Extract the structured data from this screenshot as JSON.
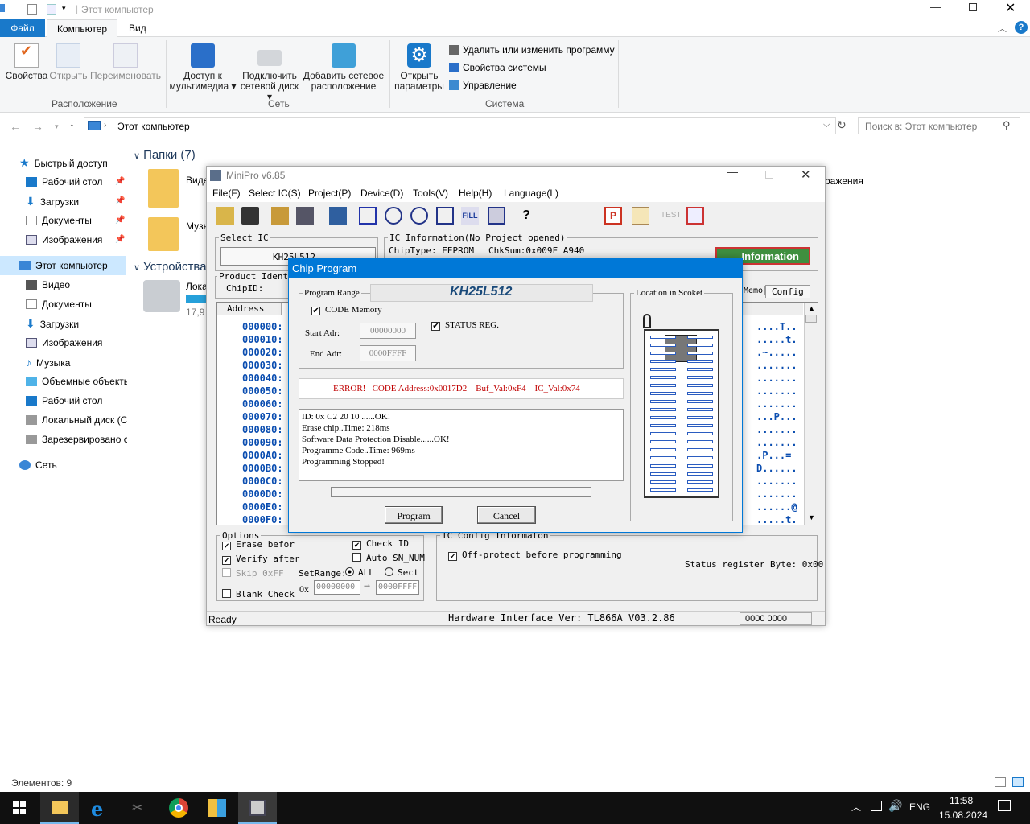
{
  "explorer": {
    "title": "Этот компьютер",
    "tabs": [
      "Файл",
      "Компьютер",
      "Вид"
    ],
    "ribbon": {
      "location": {
        "label": "Расположение",
        "buttons": [
          "Свойства",
          "Открыть",
          "Переименовать"
        ]
      },
      "network": {
        "label": "Сеть",
        "buttons": [
          [
            "Доступ к",
            "мультимедиа"
          ],
          [
            "Подключить",
            "сетевой диск"
          ],
          [
            "Добавить сетевое",
            "расположение"
          ]
        ]
      },
      "system": {
        "label": "Система",
        "open_label": [
          "Открыть",
          "параметры"
        ],
        "links": [
          "Удалить или изменить программу",
          "Свойства системы",
          "Управление"
        ]
      }
    },
    "address": "Этот компьютер",
    "search_placeholder": "Поиск в: Этот компьютер",
    "sidebar": {
      "quick": "Быстрый доступ",
      "quick_items": [
        "Рабочий стол",
        "Загрузки",
        "Документы",
        "Изображения"
      ],
      "pc": "Этот компьютер",
      "pc_items": [
        "Видео",
        "Документы",
        "Загрузки",
        "Изображения",
        "Музыка",
        "Объемные объекты",
        "Рабочий стол",
        "Локальный диск (C",
        "Зарезервировано с"
      ],
      "network": "Сеть"
    },
    "content": {
      "folders_header": "Папки (7)",
      "devices_header": "Устройства",
      "folder_partial": [
        "Виде",
        "Музы"
      ],
      "folder_right": "ражения",
      "disk_partial": "Лока",
      "disk_size": "17,9"
    },
    "status": "Элементов: 9"
  },
  "taskbar": {
    "lang": "ENG",
    "time": "11:58",
    "date": "15.08.2024"
  },
  "minipro": {
    "title": "MiniPro v6.85",
    "menu": [
      "File(F)",
      "Select IC(S)",
      "Project(P)",
      "Device(D)",
      "Tools(V)",
      "Help(H)",
      "Language(L)"
    ],
    "select_ic_legend": "Select IC",
    "selected_ic": "KH25L512",
    "icinfo_legend": "IC Information(No Project opened)",
    "chiptype": "ChipType:  EEPROM",
    "chksum": "ChkSum:0x009F A940",
    "information_btn": "Information",
    "product_ident": "Product Ident",
    "chipid": "ChipID:",
    "tab_memo": "Memo",
    "tab_config": "Config",
    "address_header": "Address",
    "hex_addresses": [
      "000000:",
      "000010:",
      "000020:",
      "000030:",
      "000040:",
      "000050:",
      "000060:",
      "000070:",
      "000080:",
      "000090:",
      "0000A0:",
      "0000B0:",
      "0000C0:",
      "0000D0:",
      "0000E0:",
      "0000F0:"
    ],
    "hex_ascii": [
      "....T..",
      ".....t.",
      ".~.....",
      ".......",
      ".......",
      ".......",
      ".......",
      "...P...",
      ".......",
      ".......",
      ".P...=",
      "D......",
      ".......",
      ".......",
      "......@",
      ".....t."
    ],
    "options_legend": "Options",
    "opt_erase": "Erase befor",
    "opt_verify": "Verify after",
    "opt_skip": "Skip 0xFF",
    "opt_blank": "Blank Check",
    "opt_checkid": "Check ID",
    "opt_autosn": "Auto SN_NUM",
    "setrange": "SetRange:",
    "range_all": "ALL",
    "range_sect": "Sect",
    "range_prefix": "0x",
    "range_start": "00000000",
    "range_end": "0000FFFF",
    "icconfig_legend": "IC Config Informaton",
    "offprotect": "Off-protect before programming",
    "status_reg_byte": "Status register Byte: 0x00",
    "status_ready": "Ready",
    "hw_interface": "Hardware Interface Ver: TL866A V03.2.86",
    "status_right": "0000 0000",
    "tool_test": "TEST"
  },
  "dialog": {
    "title": "Chip Program",
    "range_legend": "Program Range",
    "chip_name": "KH25L512",
    "code_memory": "CODE Memory",
    "status_reg": "STATUS REG.",
    "start_label": "Start Adr:",
    "start_val": "00000000",
    "end_label": "End Adr:",
    "end_val": "0000FFFF",
    "error": "ERROR!   CODE Address:0x0017D2    Buf_Val:0xF4    IC_Val:0x74",
    "log": [
      "ID: 0x C2 20 10 ......OK!",
      "Erase chip..Time: 218ms",
      "Software Data Protection Disable......OK!",
      "Programme Code..Time: 969ms",
      "Programming Stopped!"
    ],
    "socket_legend": "Location in Scoket",
    "program_btn": "Program",
    "cancel_btn": "Cancel"
  },
  "colors": {
    "accent": "#0078d7",
    "hex_blue": "#0a4db0",
    "error_red": "#c00000"
  }
}
